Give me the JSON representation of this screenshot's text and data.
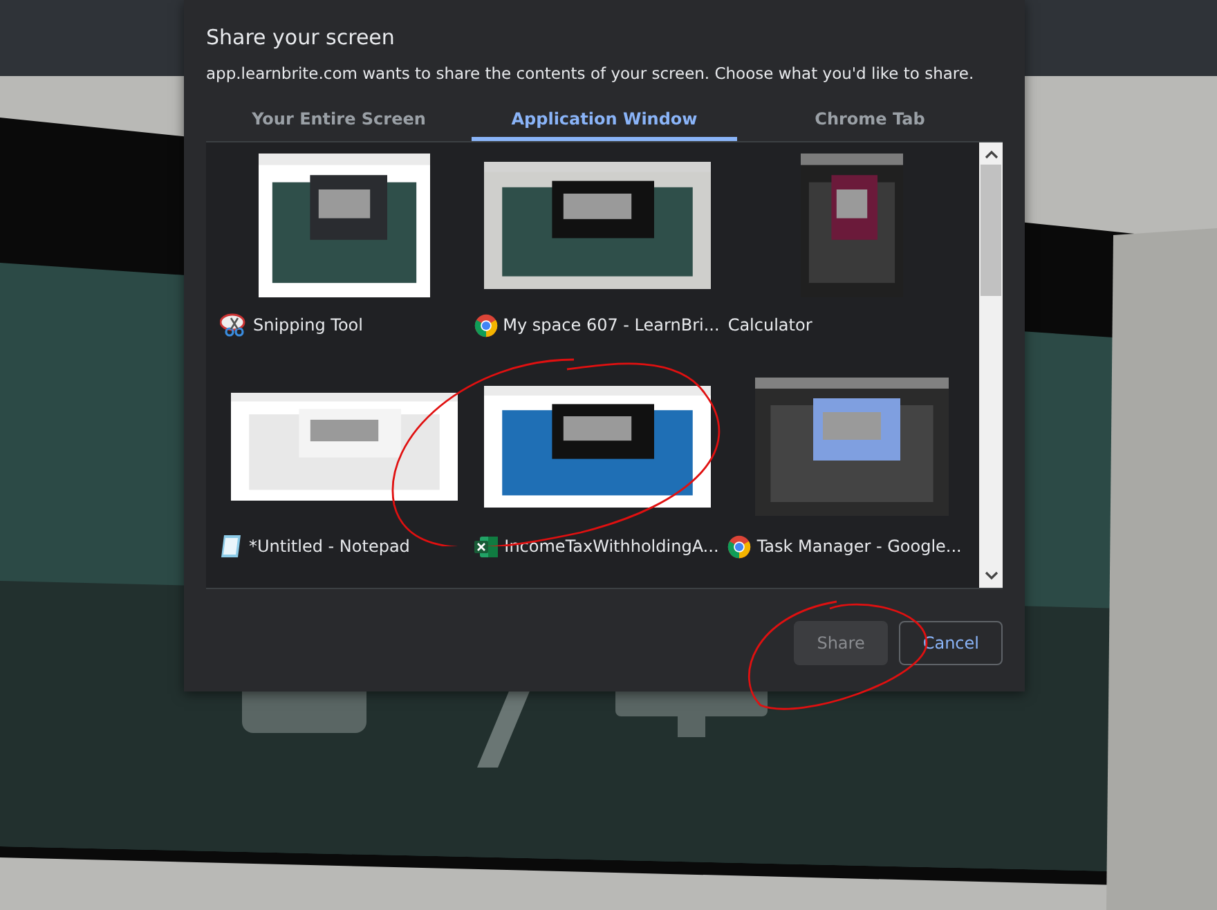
{
  "dialog": {
    "title": "Share your screen",
    "description": "app.learnbrite.com wants to share the contents of your screen. Choose what you'd like to share."
  },
  "tabs": [
    {
      "label": "Your Entire Screen",
      "selected": false
    },
    {
      "label": "Application Window",
      "selected": true
    },
    {
      "label": "Chrome Tab",
      "selected": false
    }
  ],
  "windows": [
    {
      "label": "Snipping Tool",
      "kind": "snipping",
      "selected": false
    },
    {
      "label": "My space 607 - LearnBri...",
      "kind": "chrome",
      "selected": false
    },
    {
      "label": "Calculator",
      "selected": false
    },
    {
      "label": "*Untitled - Notepad",
      "kind": "notepad",
      "selected": false
    },
    {
      "label": "IncomeTaxWithholdingA...",
      "kind": "excel",
      "selected": false
    },
    {
      "label": "Task Manager - Google...",
      "kind": "chrome",
      "selected": false
    }
  ],
  "buttons": [
    {
      "label": "Share",
      "disabled": true
    },
    {
      "label": "Cancel",
      "disabled": false
    }
  ]
}
